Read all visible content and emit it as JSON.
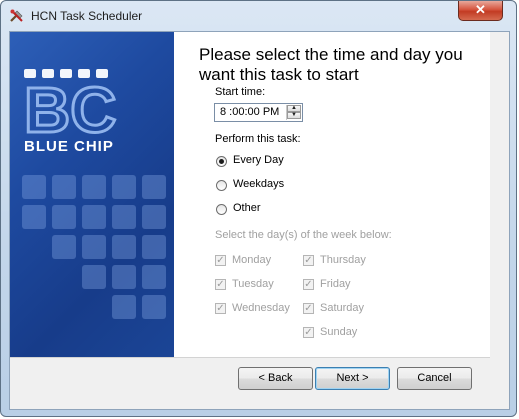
{
  "window": {
    "title": "HCN Task Scheduler",
    "close_label": "✕"
  },
  "banner": {
    "brand_text": "BLUE CHIP",
    "logo_letters": "BC"
  },
  "heading": "Please select the time and day you want this task to start",
  "start_time": {
    "label": "Start time:",
    "value": "8 :00:00 PM"
  },
  "perform": {
    "label": "Perform this task:",
    "options": [
      {
        "label": "Every Day",
        "selected": true
      },
      {
        "label": "Weekdays",
        "selected": false
      },
      {
        "label": "Other",
        "selected": false
      }
    ]
  },
  "days": {
    "label": "Select the day(s) of the week below:",
    "items": [
      {
        "label": "Monday",
        "checked": true
      },
      {
        "label": "Tuesday",
        "checked": true
      },
      {
        "label": "Wednesday",
        "checked": true
      },
      {
        "label": "Thursday",
        "checked": true
      },
      {
        "label": "Friday",
        "checked": true
      },
      {
        "label": "Saturday",
        "checked": true
      },
      {
        "label": "Sunday",
        "checked": true
      }
    ]
  },
  "buttons": {
    "back": "< Back",
    "next": "Next >",
    "cancel": "Cancel"
  },
  "colors": {
    "banner": "#1e4aa0",
    "disabled_text": "#a0a0a0"
  }
}
